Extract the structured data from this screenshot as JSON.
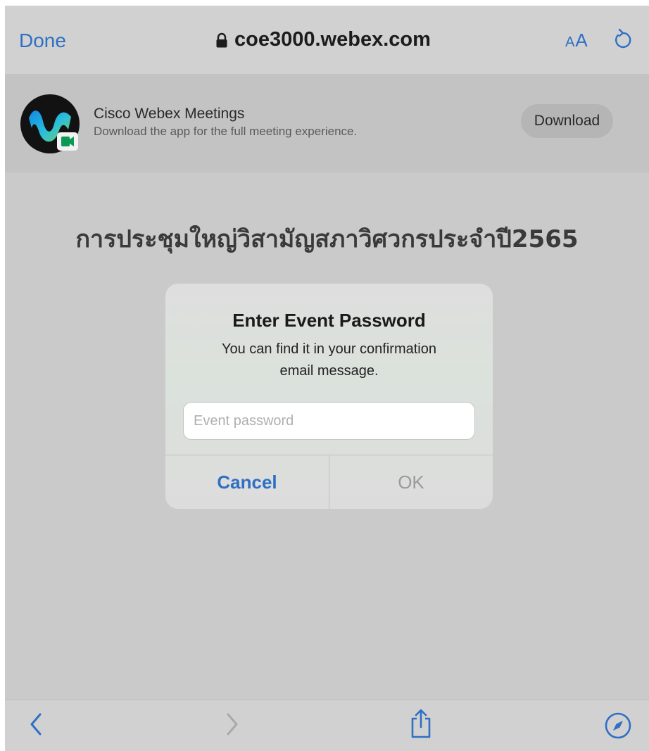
{
  "topbar": {
    "done_label": "Done",
    "url": "coe3000.webex.com",
    "lock_icon": "lock-icon",
    "text_size_small": "A",
    "text_size_large": "A",
    "reload_icon": "reload-icon"
  },
  "banner": {
    "app_name": "Cisco Webex Meetings",
    "app_subtitle": "Download the app for the full meeting experience.",
    "download_label": "Download",
    "app_icon": "webex-app-icon"
  },
  "page": {
    "heading": "การประชุมใหญ่วิสามัญสภาวิศวกรประจำปี2565"
  },
  "dialog": {
    "title": "Enter Event Password",
    "message_line1": "You can find it in your confirmation",
    "message_line2": "email message.",
    "input_placeholder": "Event password",
    "cancel_label": "Cancel",
    "ok_label": "OK"
  },
  "toolbar": {
    "back_icon": "back-icon",
    "forward_icon": "forward-icon",
    "share_icon": "share-icon",
    "compass_icon": "compass-icon"
  },
  "colors": {
    "accent": "#2f6fc4",
    "background": "#cacaca",
    "bar": "#d1d1d1"
  }
}
